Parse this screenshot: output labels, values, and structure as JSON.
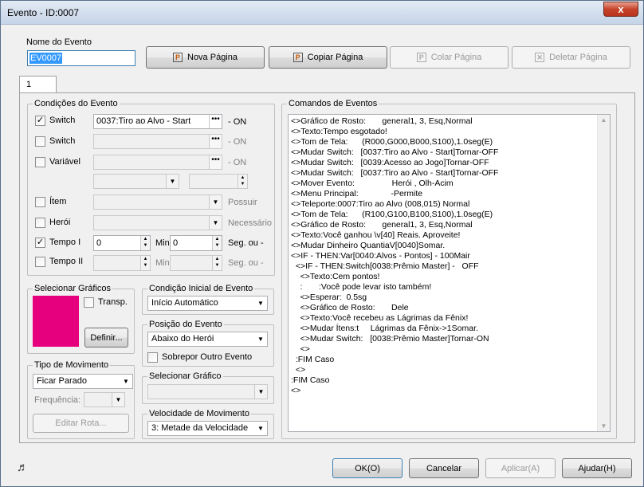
{
  "window": {
    "title": "Evento - ID:0007",
    "close_label": "x"
  },
  "event_name": {
    "label": "Nome do Evento",
    "value": "EV0007"
  },
  "toolbar": {
    "new_page": "Nova Página",
    "copy_page": "Copiar Página",
    "paste_page": "Colar Página",
    "delete_page": "Deletar Página"
  },
  "tabs": [
    {
      "label": "1"
    }
  ],
  "conditions": {
    "label": "Condições do Evento",
    "switch1": {
      "label": "Switch",
      "checked": "✓",
      "value": "0037:Tiro ao Alvo - Start",
      "suffix": "- ON"
    },
    "switch2": {
      "label": "Switch",
      "value": "",
      "suffix": "- ON"
    },
    "variable": {
      "label": "Variável",
      "suffix": "- ON"
    },
    "item": {
      "label": "Ítem",
      "suffix": "Possuir"
    },
    "hero": {
      "label": "Herói",
      "suffix": "Necessário"
    },
    "timer1": {
      "label": "Tempo I",
      "checked": "✓",
      "min_value": "0",
      "min_label": "Min",
      "sec_value": "0",
      "sec_label": "Seg. ou -"
    },
    "timer2": {
      "label": "Tempo II",
      "min_label": "Min",
      "sec_label": "Seg. ou -"
    }
  },
  "graphics": {
    "label": "Selecionar Gráficos",
    "transparent_label": "Transp.",
    "define_label": "Definir...",
    "preview_color": "#e6007e"
  },
  "start_condition": {
    "label": "Condição Inicial de Evento",
    "value": "Início Automático"
  },
  "event_position": {
    "label": "Posição do Evento",
    "value": "Abaixo do Herói",
    "overlap_label": "Sobrepor Outro Evento"
  },
  "select_graphic": {
    "label": "Selecionar Gráfico",
    "value": ""
  },
  "movement_type": {
    "label": "Tipo de Movimento",
    "value": "Ficar Parado",
    "frequency_label": "Frequência:",
    "edit_route_label": "Editar Rota..."
  },
  "movement_speed": {
    "label": "Velocidade de Movimento",
    "value": "3: Metade da Velocidade"
  },
  "commands": {
    "label": "Comandos de Eventos",
    "lines": [
      "<>Gráfico de Rosto:       general1, 3, Esq,Normal",
      "<>Texto:Tempo esgotado!",
      "<>Tom de Tela:      (R000,G000,B000,S100),1.0seg(E)",
      "<>Mudar Switch:   [0037:Tiro ao Alvo - Start]Tornar-OFF",
      "<>Mudar Switch:   [0039:Acesso ao Jogo]Tornar-OFF",
      "<>Mudar Switch:   [0037:Tiro ao Alvo - Start]Tornar-OFF",
      "<>Mover Evento:                Herói , Olh-Acim",
      "<>Menu Principal:              -Permite",
      "<>Teleporte:0007:Tiro ao Alvo (008,015) Normal",
      "<>Tom de Tela:      (R100,G100,B100,S100),1.0seg(E)",
      "<>Gráfico de Rosto:       general1, 3, Esq,Normal",
      "<>Texto:Você ganhou \\v[40] Reais. Aproveite!",
      "<>Mudar Dinheiro QuantiaV[0040]Somar.",
      "<>IF - THEN:Var[0040:Alvos - Pontos] - 100Mair",
      "  <>IF - THEN:Switch[0038:Prêmio Master] -   OFF",
      "    <>Texto:Cem pontos!",
      "    :       :Você pode levar isto também!",
      "    <>Esperar:  0.5sg",
      "    <>Gráfico de Rosto:       Dele",
      "    <>Texto:Você recebeu as Lágrimas da Fênix!",
      "    <>Mudar Ítens:t     Lágrimas da Fênix->1Somar.",
      "    <>Mudar Switch:   [0038:Prêmio Master]Tornar-ON",
      "    <>",
      "  :FIM Caso",
      "  <>",
      ":FIM Caso",
      "<>"
    ]
  },
  "footer": {
    "ok": "OK(O)",
    "cancel": "Cancelar",
    "apply": "Aplicar(A)",
    "help": "Ajudar(H)",
    "music_icon": "♬"
  }
}
